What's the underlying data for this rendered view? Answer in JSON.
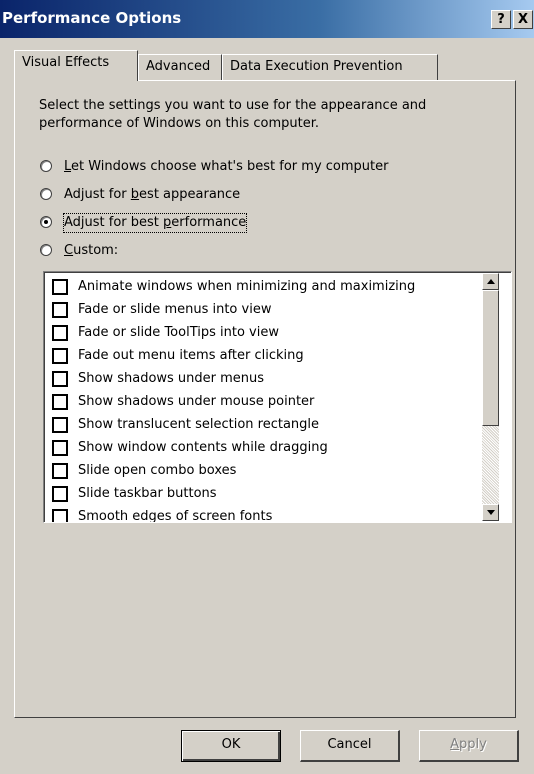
{
  "window": {
    "title": "Performance Options",
    "help_btn": "?",
    "close_btn": "X"
  },
  "tabs": [
    {
      "label": "Visual Effects",
      "active": true
    },
    {
      "label": "Advanced",
      "active": false
    },
    {
      "label": "Data Execution Prevention",
      "active": false
    }
  ],
  "description": "Select the settings you want to use for the appearance and performance of Windows on this computer.",
  "radios": [
    {
      "pre": "",
      "ul": "L",
      "post": "et Windows choose what's best for my computer",
      "selected": false
    },
    {
      "pre": "Adjust for ",
      "ul": "b",
      "post": "est appearance",
      "selected": false
    },
    {
      "pre": "Adjust for best ",
      "ul": "p",
      "post": "erformance",
      "selected": true
    },
    {
      "pre": "",
      "ul": "C",
      "post": "ustom:",
      "selected": false
    }
  ],
  "effects": [
    {
      "label": "Animate windows when minimizing and maximizing",
      "checked": false
    },
    {
      "label": "Fade or slide menus into view",
      "checked": false
    },
    {
      "label": "Fade or slide ToolTips into view",
      "checked": false
    },
    {
      "label": "Fade out menu items after clicking",
      "checked": false
    },
    {
      "label": "Show shadows under menus",
      "checked": false
    },
    {
      "label": "Show shadows under mouse pointer",
      "checked": false
    },
    {
      "label": "Show translucent selection rectangle",
      "checked": false
    },
    {
      "label": "Show window contents while dragging",
      "checked": false
    },
    {
      "label": "Slide open combo boxes",
      "checked": false
    },
    {
      "label": "Slide taskbar buttons",
      "checked": false
    },
    {
      "label": "Smooth edges of screen fonts",
      "checked": false
    }
  ],
  "buttons": {
    "ok": "OK",
    "cancel": "Cancel",
    "apply_ul": "A",
    "apply_rest": "pply"
  }
}
